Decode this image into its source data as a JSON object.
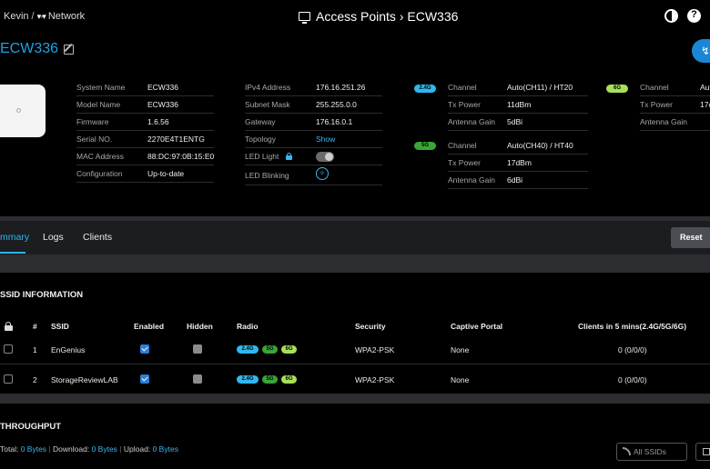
{
  "header": {
    "breadcrumb_user": "Kevin",
    "breadcrumb_sep": "/",
    "breadcrumb_network": "Network",
    "title": "Access Points › ECW336"
  },
  "device": {
    "name": "ECW336",
    "info": {
      "system_name_label": "System Name",
      "system_name": "ECW336",
      "model_name_label": "Model Name",
      "model_name": "ECW336",
      "firmware_label": "Firmware",
      "firmware": "1.6.56",
      "serial_label": "Serial NO.",
      "serial": "2270E4T1ENTG",
      "mac_label": "MAC Address",
      "mac": "88:DC:97:0B:15:E0",
      "config_label": "Configuration",
      "config": "Up-to-date"
    },
    "network": {
      "ipv4_label": "IPv4 Address",
      "ipv4": "176.16.251.26",
      "subnet_label": "Subnet Mask",
      "subnet": "255.255.0.0",
      "gateway_label": "Gateway",
      "gateway": "176.16.0.1",
      "topology_label": "Topology",
      "topology": "Show",
      "led_light_label": "LED Light",
      "led_light_on": true,
      "led_blink_label": "LED Blinking"
    },
    "radio_24": {
      "band": "2.4G",
      "channel_label": "Channel",
      "channel": "Auto(CH11) / HT20",
      "tx_label": "Tx Power",
      "tx": "11dBm",
      "gain_label": "Antenna Gain",
      "gain": "5dBi"
    },
    "radio_5": {
      "band": "5G",
      "channel_label": "Channel",
      "channel": "Auto(CH40) / HT40",
      "tx_label": "Tx Power",
      "tx": "17dBm",
      "gain_label": "Antenna Gain",
      "gain": "6dBi"
    },
    "radio_6": {
      "band": "6G",
      "channel_label": "Channel",
      "channel": "Aut",
      "tx_label": "Tx Power",
      "tx": "17c",
      "gain_label": "Antenna Gain"
    }
  },
  "tabs": [
    "mmary",
    "Logs",
    "Clients"
  ],
  "reset_label": "Reset",
  "ssid_section": {
    "title": "SSID INFORMATION",
    "headers": {
      "num": "#",
      "ssid": "SSID",
      "enabled": "Enabled",
      "hidden": "Hidden",
      "radio": "Radio",
      "security": "Security",
      "captive": "Captive Portal",
      "clients": "Clients in 5 mins(2.4G/5G/6G)"
    },
    "rows": [
      {
        "num": "1",
        "ssid": "EnGenius",
        "enabled": true,
        "hidden": false,
        "bands": [
          "2.4G",
          "5G",
          "6G"
        ],
        "security": "WPA2-PSK",
        "captive": "None",
        "clients": "0 (0/0/0)"
      },
      {
        "num": "2",
        "ssid": "StorageReviewLAB",
        "enabled": true,
        "hidden": false,
        "bands": [
          "2.4G",
          "5G",
          "6G"
        ],
        "security": "WPA2-PSK",
        "captive": "None",
        "clients": "0 (0/0/0)"
      }
    ]
  },
  "throughput": {
    "title": "THROUGHPUT",
    "total_label": "Total:",
    "total": "0 Bytes",
    "download_label": "Download:",
    "download": "0 Bytes",
    "upload_label": "Upload:",
    "upload": "0 Bytes",
    "ssid_filter": "All SSIDs"
  }
}
